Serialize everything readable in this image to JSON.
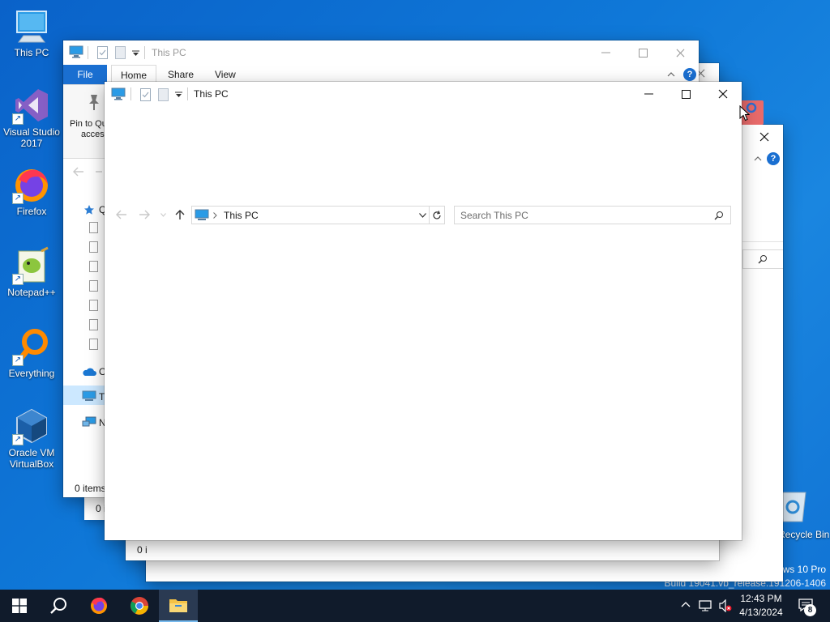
{
  "desktop": {
    "icons": [
      {
        "label": "This PC",
        "name": "this-pc"
      },
      {
        "label": "Visual Studio 2017",
        "name": "visual-studio-2017"
      },
      {
        "label": "Firefox",
        "name": "firefox"
      },
      {
        "label": "Notepad++",
        "name": "notepad-plus-plus"
      },
      {
        "label": "Everything",
        "name": "everything"
      },
      {
        "label": "Oracle VM VirtualBox",
        "name": "oracle-vm-virtualbox"
      }
    ],
    "recycle_bin_label": "Recycle Bin",
    "watermark_line1": "ows 10 Pro",
    "watermark_line2": "Build 19041.vb_release.191206-1406"
  },
  "window_back": {
    "title": "This PC",
    "tabs": {
      "file": "File",
      "home": "Home",
      "share": "Share",
      "view": "View"
    },
    "ribbon_pin_label_line1": "Pin to Qu",
    "ribbon_pin_label_line2": "acces",
    "nav_items": {
      "onedrive": "O",
      "this_pc": "T",
      "network": "N"
    },
    "status": "0 items"
  },
  "window_third": {
    "status": "0 i"
  },
  "window_fourth": {
    "status": "0 i"
  },
  "window_front": {
    "title": "This PC",
    "address_path": "This PC",
    "search_placeholder": "Search This PC"
  },
  "taskbar": {
    "time": "12:43 PM",
    "date": "4/13/2024",
    "notification_count": "8"
  },
  "colors": {
    "accent": "#1a6fd1",
    "file_tab": "#1a6fd1",
    "taskbar": "#101b2b",
    "selection": "#cce8ff"
  }
}
